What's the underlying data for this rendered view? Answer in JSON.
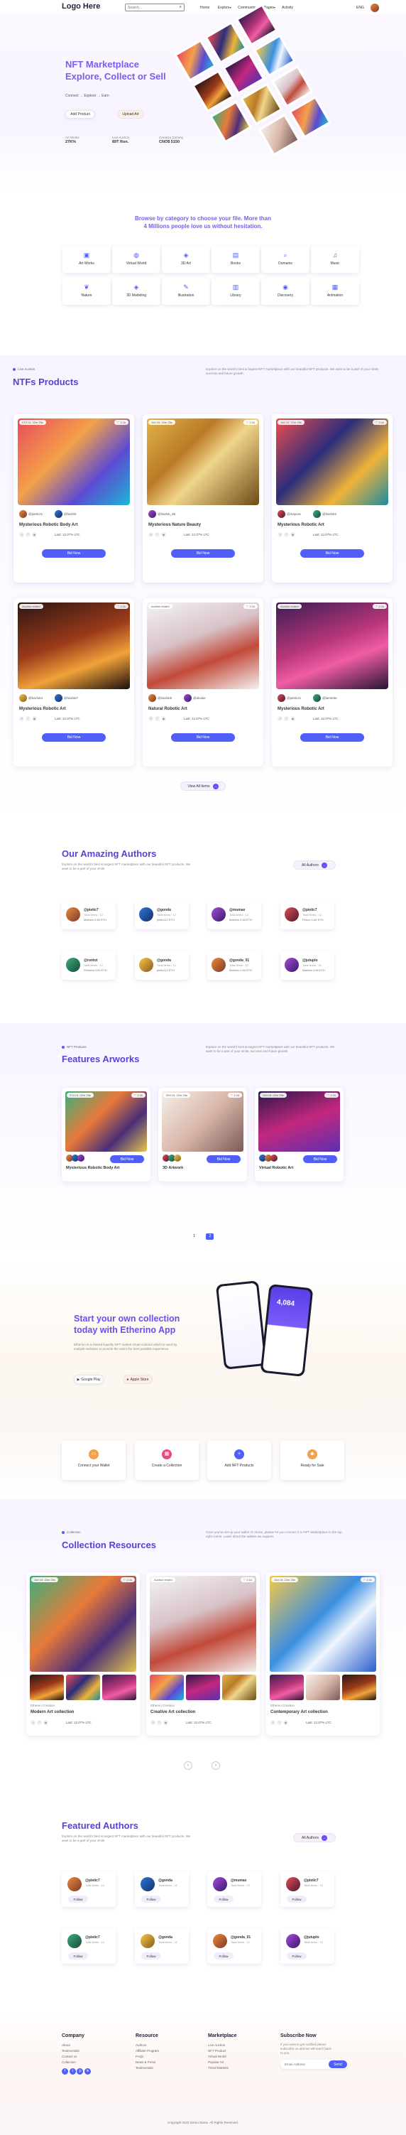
{
  "header": {
    "logo": "Logo Here",
    "search_placeholder": "Search...",
    "nav": [
      "Home",
      "Explore",
      "Community",
      "Pages",
      "Activity"
    ],
    "lang": "ENG"
  },
  "hero": {
    "title_line1": "NFT Marketplace",
    "title_line2": "Explore, Collect or Sell",
    "breadcrumb": [
      "Connect",
      "Explore",
      "Earn"
    ],
    "primary_button": "Add Product",
    "secondary_button": "Upload Art",
    "stats": [
      {
        "label": "Art Works",
        "value": "27K%"
      },
      {
        "label": "Live Auction",
        "value": "89T Ron."
      },
      {
        "label": "Creators Earning",
        "value": "CNO$ 5150"
      }
    ]
  },
  "categories": {
    "title_line1": "Browse by category to choose your file. More than",
    "title_line2": "4 Millions people love us without hesitation.",
    "items": [
      {
        "label": "Art Works",
        "icon": "image-icon"
      },
      {
        "label": "Virtual World",
        "icon": "globe-icon"
      },
      {
        "label": "3D Art",
        "icon": "cube-icon"
      },
      {
        "label": "Books",
        "icon": "book-icon"
      },
      {
        "label": "Domains",
        "icon": "search-icon"
      },
      {
        "label": "Music",
        "icon": "music-icon"
      },
      {
        "label": "Nature",
        "icon": "leaf-icon"
      },
      {
        "label": "3D Modeling",
        "icon": "cube-icon"
      },
      {
        "label": "Illustration",
        "icon": "pen-icon"
      },
      {
        "label": "Library",
        "icon": "library-icon"
      },
      {
        "label": "Discovery",
        "icon": "camera-icon"
      },
      {
        "label": "Animation",
        "icon": "film-icon"
      }
    ]
  },
  "products": {
    "eyebrow": "Live Auction",
    "title": "NTFs Products",
    "description": "Explore on the world's best & largest NFT marketplace with our beautiful NFT products. We want to be a part of your smile, success and future growth.",
    "view_all": "View All Items",
    "items": [
      {
        "timer": "07d 14: 22m 25s",
        "likes": "2.1k",
        "users": "@pietic21",
        "user2": "@hazlok",
        "title": "Mysterious Robotic Body Art",
        "price": "Last: 12.07% LTC",
        "button": "Bid Now"
      },
      {
        "timer": "15d 16: 22m 25s",
        "likes": "2.1k",
        "users": "@hazlok_86",
        "user2": "",
        "title": "Mysterious Nature Beauty",
        "price": "Last: 12.07% LTC",
        "button": "Bid Now"
      },
      {
        "timer": "16d 15: 22m 25s",
        "likes": "2.1k",
        "users": "@mayura",
        "user2": "@hazlok2",
        "title": "Mysterious Robotic Art",
        "price": "Last: 12.07% LTC",
        "button": "Bid Now"
      },
      {
        "timer": "Auction ended",
        "likes": "2.1k",
        "users": "@hazlok4",
        "user2": "@hazlok7",
        "title": "Mysterious Robotic Art",
        "price": "Last: 12.07% LTC",
        "button": "Bid Now"
      },
      {
        "timer": "Auction ended",
        "likes": "2.1k",
        "users": "@hazlok5",
        "user2": "@alcalor",
        "title": "Natural Robotic Art",
        "price": "Last: 12.07% LTC",
        "button": "Bid Now"
      },
      {
        "timer": "Auction ended",
        "likes": "2.1k",
        "users": "@pietic21",
        "user2": "@lamente",
        "title": "Mysterious Robotic Art",
        "price": "Last: 12.07% LTC",
        "button": "Bid Now"
      }
    ]
  },
  "authors": {
    "title": "Our Amazing Authors",
    "description": "Explore on the world's best & largest NFT marketplace with our beautiful NFT products. We want to be a part of your smile.",
    "all_button": "All Authors",
    "items": [
      {
        "name": "@pietic7",
        "sub": "Total items : 12",
        "meta": "Mathew 0.65 ETH"
      },
      {
        "name": "@gonda",
        "sub": "Total items : 12",
        "meta": "pietic112 ETH"
      },
      {
        "name": "@mumax",
        "sub": "Total items : 12",
        "meta": "Mathew 0.65 ETH"
      },
      {
        "name": "@pietic7",
        "sub": "Total items : 12",
        "meta": "Pidroo 0.65 ETH"
      },
      {
        "name": "@rontot",
        "sub": "Total items : 12",
        "meta": "Pidrioba 0.65 ETH"
      },
      {
        "name": "@gonda",
        "sub": "Total items : 12",
        "meta": "pietic112 ETH"
      },
      {
        "name": "@gonda_01",
        "sub": "Total items : 12",
        "meta": "Mathew 0.65 ETH"
      },
      {
        "name": "@jutuplo",
        "sub": "Total items : 12",
        "meta": "Mathew 0.65 ETH"
      }
    ]
  },
  "features": {
    "eyebrow": "NFT Products",
    "title": "Features Arworks",
    "description": "Explore on the world's best & largest NFT marketplace with our beautiful NFT products. We want to be a part of your smile, success and future growth.",
    "items": [
      {
        "timer": "07d 14: 22m 25s",
        "likes": "2.1k",
        "title": "Mysterious Robotic Body Art",
        "button": "Bid Now"
      },
      {
        "timer": "09d 15: 22m 25s",
        "likes": "2.1k",
        "title": "3D Artwork",
        "button": "Bid Now"
      },
      {
        "timer": "10d 15: 22m 25s",
        "likes": "2.1k",
        "title": "Virtual Robotic Art",
        "button": "Bid Now"
      }
    ],
    "pages": [
      "1",
      "2"
    ]
  },
  "app": {
    "title_line1": "Start your own collection",
    "title_line2": "today with Etherino App",
    "description": "Etherino is a shared liquidity NFT market smart contract which is used by multiple websites to provide the users the best possible experience.",
    "store1": "Google Play",
    "store2": "Apple Store",
    "phone_value": "4,084",
    "steps": [
      {
        "label": "Connect your Wallet",
        "icon": "wallet-icon",
        "color": "#f0a14a"
      },
      {
        "label": "Create a Collection",
        "icon": "grid-icon",
        "color": "#e84b7b"
      },
      {
        "label": "Add NFT Products",
        "icon": "plus-icon",
        "color": "#4f5ff8"
      },
      {
        "label": "Ready for Sale",
        "icon": "tag-icon",
        "color": "#f0a14a"
      }
    ]
  },
  "collections": {
    "eyebrow": "Collection",
    "title": "Collection Resources",
    "description": "Once you've set up your wallet of choice, please let you connect it to NFT Marketplace in the top right corner. Learn about the wallets we support.",
    "items": [
      {
        "timer": "15d 15: 22m 25s",
        "likes": "2.1k",
        "creator": "Ethereo Creation",
        "title": "Modern Art collection",
        "price": "Last: 12.07% LTC"
      },
      {
        "timer": "Auction ended",
        "likes": "2.1k",
        "creator": "Ethereo Creation",
        "title": "Creative Art collection",
        "price": "Last: 12.07% LTC"
      },
      {
        "timer": "15d 15: 22m 25s",
        "likes": "2.1k",
        "creator": "Ethereo Creation",
        "title": "Contemporary Art collection",
        "price": "Last: 12.07% LTC"
      }
    ]
  },
  "featured_authors": {
    "title": "Featured Authors",
    "description": "Explore on the world's best & largest NFT marketplace with our beautiful NFT products. We want to be a part of your smile.",
    "all_button": "All Authors",
    "follow": "Follow",
    "items": [
      {
        "name": "@pietic7",
        "sub": "Total items : 12"
      },
      {
        "name": "@gonda",
        "sub": "Total items : 12"
      },
      {
        "name": "@mumax",
        "sub": "Total items : 12"
      },
      {
        "name": "@pietic7",
        "sub": "Total items : 12"
      },
      {
        "name": "@pietic7",
        "sub": "Total items : 12"
      },
      {
        "name": "@gonda",
        "sub": "Total items : 12"
      },
      {
        "name": "@gonda_01",
        "sub": "Total items : 12"
      },
      {
        "name": "@jutuplo",
        "sub": "Total items : 12"
      }
    ]
  },
  "footer": {
    "col1": {
      "title": "Company",
      "links": [
        "About",
        "Testimonials",
        "Contact us",
        "Collection"
      ]
    },
    "col2": {
      "title": "Resource",
      "links": [
        "Authors",
        "Affiliate Program",
        "FAQs",
        "News & Press",
        "Testimonials"
      ]
    },
    "col3": {
      "title": "Marketplace",
      "links": [
        "Live Auction",
        "NFT Product",
        "Virtual World",
        "Popular Art",
        "Trend Markets"
      ]
    },
    "col4": {
      "title": "Subscribe Now",
      "text": "If you want to get notified please subscribe us and we will reach back to you.",
      "placeholder": "Email Address",
      "button": "Send"
    },
    "copyright": "Copyright 2022 Demo Name. All Rights Reserved."
  }
}
